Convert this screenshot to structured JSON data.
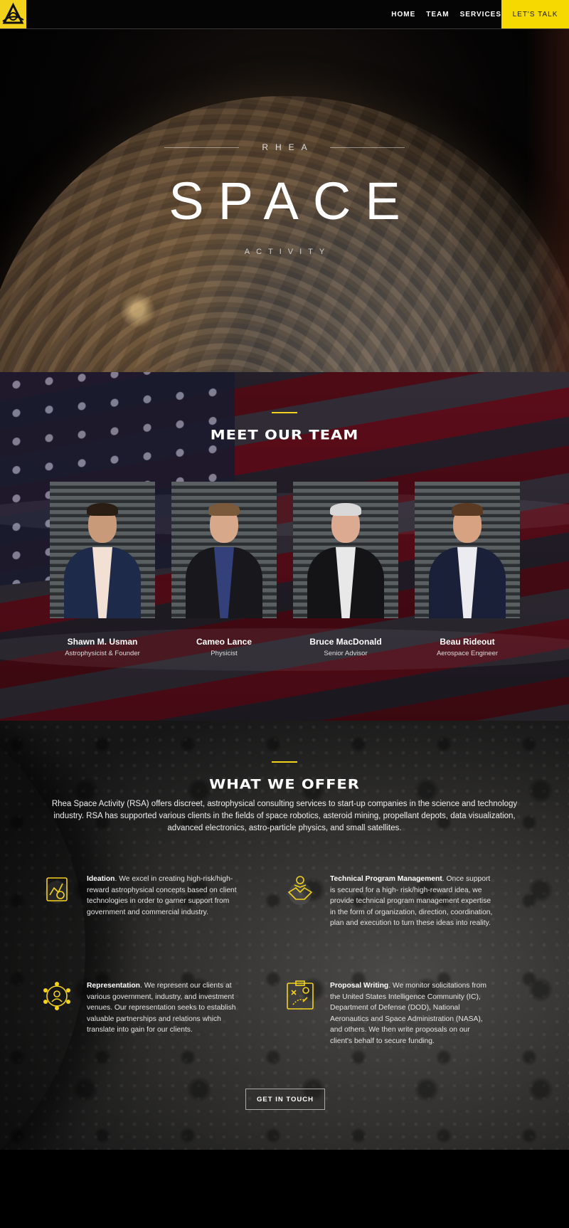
{
  "nav": {
    "links": [
      "HOME",
      "TEAM",
      "SERVICES"
    ],
    "cta": "LET'S TALK"
  },
  "hero": {
    "eyebrow": "RHEA",
    "title": "SPACE",
    "subtitle": "ACTIVITY"
  },
  "team": {
    "title": "MEET OUR TEAM",
    "members": [
      {
        "name": "Shawn M. Usman",
        "role": "Astrophysicist & Founder"
      },
      {
        "name": "Cameo Lance",
        "role": "Physicist"
      },
      {
        "name": "Bruce MacDonald",
        "role": "Senior Advisor"
      },
      {
        "name": "Beau Rideout",
        "role": "Aerospace Engineer"
      }
    ]
  },
  "offer": {
    "title": "WHAT WE OFFER",
    "intro": "Rhea Space Activity (RSA) offers discreet, astrophysical consulting services to start-up companies in the science and technology industry. RSA has supported various clients in the fields of space robotics, asteroid mining, propellant depots, data visualization, advanced electronics, astro-particle physics, and small satellites.",
    "items": [
      {
        "icon": "blueprint-icon",
        "heading": "Ideation",
        "text": ". We excel in creating high-risk/high-reward astrophysical concepts based on client technologies in order to garner support from government and commercial industry."
      },
      {
        "icon": "handshake-icon",
        "heading": "Technical Program Management",
        "text": ". Once support is secured for a high- risk/high-reward idea, we provide technical program management expertise in the form of organization, direction, coordination, plan and execution to turn these ideas into reality."
      },
      {
        "icon": "network-icon",
        "heading": "Representation",
        "text": ". We represent our clients at various government, industry, and investment venues. Our representation seeks to establish valuable partnerships and relations which translate into gain for our clients."
      },
      {
        "icon": "strategy-board-icon",
        "heading": "Proposal Writing",
        "text": ". We monitor solicitations from the United States Intelligence Community (IC), Department of Defense (DOD), National Aeronautics and Space Administration (NASA), and others. We then write proposals on our client's behalf to secure funding."
      }
    ],
    "cta": "GET IN TOUCH"
  },
  "colors": {
    "accent": "#f3d21c",
    "background": "#000000"
  }
}
